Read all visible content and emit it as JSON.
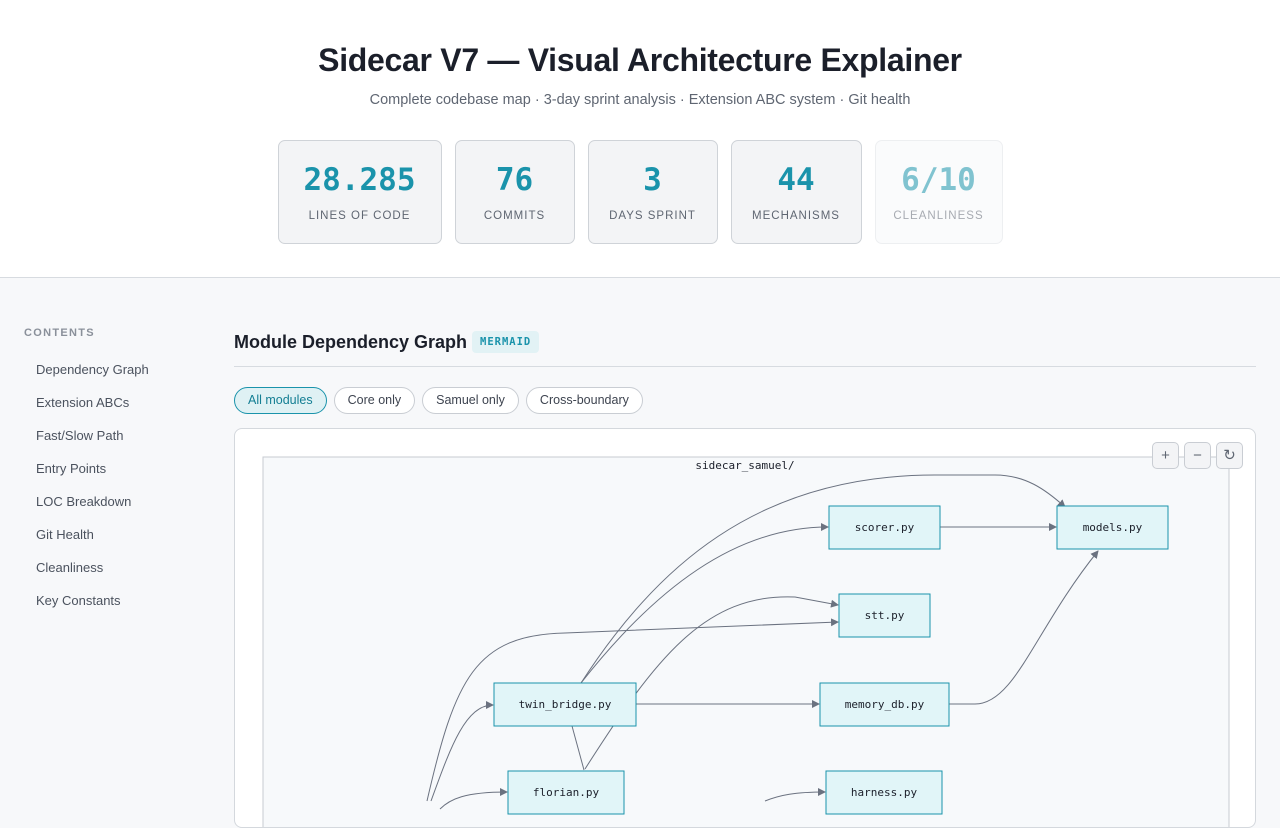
{
  "header": {
    "title": "Sidecar V7 — Visual Architecture Explainer",
    "subtitle": "Complete codebase map · 3-day sprint analysis · Extension ABC system · Git health"
  },
  "stats": [
    {
      "value": "28.285",
      "label": "Lines of Code"
    },
    {
      "value": "76",
      "label": "Commits"
    },
    {
      "value": "3",
      "label": "Days Sprint"
    },
    {
      "value": "44",
      "label": "Mechanisms"
    },
    {
      "value": "6/10",
      "label": "Cleanliness"
    }
  ],
  "sidebar": {
    "title": "CONTENTS",
    "items": [
      {
        "label": "Dependency Graph"
      },
      {
        "label": "Extension ABCs"
      },
      {
        "label": "Fast/Slow Path"
      },
      {
        "label": "Entry Points"
      },
      {
        "label": "LOC Breakdown"
      },
      {
        "label": "Git Health"
      },
      {
        "label": "Cleanliness"
      },
      {
        "label": "Key Constants"
      }
    ]
  },
  "section": {
    "title": "Module Dependency Graph",
    "badge": "MERMAID"
  },
  "filters": [
    {
      "label": "All modules",
      "active": true
    },
    {
      "label": "Core only",
      "active": false
    },
    {
      "label": "Samuel only",
      "active": false
    },
    {
      "label": "Cross-boundary",
      "active": false
    }
  ],
  "graph": {
    "zoom_in": "+",
    "zoom_out": "−",
    "reset": "↻",
    "cluster_label": "sidecar_samuel/",
    "nodes": {
      "scorer": "scorer.py",
      "models": "models.py",
      "stt": "stt.py",
      "twin_bridge": "twin_bridge.py",
      "memory_db": "memory_db.py",
      "florian": "florian.py",
      "harness": "harness.py"
    }
  },
  "colors": {
    "accent": "#1a93ab",
    "node_fill": "#e1f5f8",
    "node_stroke": "#1a93ab"
  }
}
